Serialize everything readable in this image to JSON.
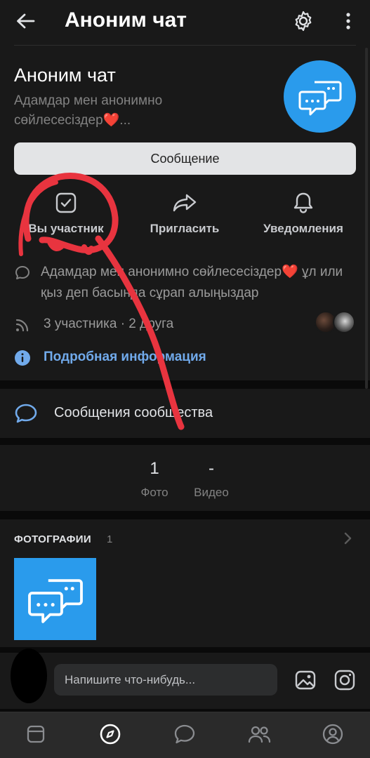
{
  "header": {
    "title": "Аноним чат"
  },
  "community": {
    "name": "Аноним чат",
    "short_description": "Адамдар мен анонимно сөйлесесіздер❤️...",
    "message_button": "Сообщение"
  },
  "actions": [
    {
      "label": "Вы участник",
      "icon": "checkbox-icon"
    },
    {
      "label": "Пригласить",
      "icon": "share-icon"
    },
    {
      "label": "Уведомления",
      "icon": "bell-icon"
    }
  ],
  "info": {
    "description": "Адамдар мен анонимно сөйлесесіздер❤️ ұл или қыз деп басында сұрап алыңыздар",
    "members": "3 участника · 2 друга",
    "details_link": "Подробная информация"
  },
  "community_messages": {
    "label": "Сообщения сообщества"
  },
  "counters": [
    {
      "value": "1",
      "label": "Фото"
    },
    {
      "value": "-",
      "label": "Видео"
    }
  ],
  "photos": {
    "title": "ФОТОГРАФИИ",
    "count": "1"
  },
  "composer": {
    "placeholder": "Напишите что-нибудь..."
  },
  "bottom_nav": [
    "news-icon",
    "discover-icon",
    "messages-icon",
    "friends-icon",
    "profile-icon"
  ],
  "colors": {
    "accent": "#2a9bec",
    "link": "#71aaeb",
    "background": "#191919",
    "annotation": "#e8343f"
  }
}
